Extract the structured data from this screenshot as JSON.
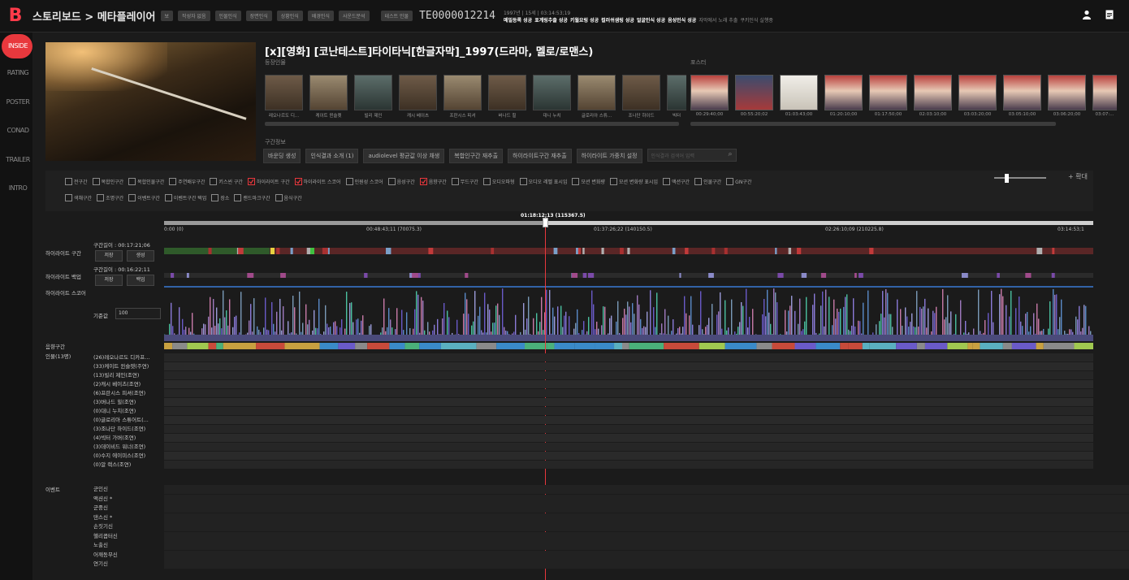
{
  "app": {
    "logo": "B",
    "breadcrumb": "스토리보드 > 메타플레이어",
    "top_buttons": [
      "보",
      "작성자 없음",
      "인물인식",
      "장면인식",
      "상황인식",
      "배경인식",
      "사운드분석"
    ],
    "extra_button": "테스트 인물",
    "content_code": "TE0000012214",
    "status_line1": "1997년 | 15세 | 03:14:53;19",
    "status_items": [
      "메밀등록 성공",
      "표계링추출 성공",
      "키월요링 성공",
      "컬러쉬샘링 성공",
      "얼굴인식 성공",
      "음성인식 성공",
      "자막에서 노래 추출",
      "쿠키인식 실행중"
    ],
    "status_dim_items": [
      "자막에서 노래 추출",
      "쿠키인식 실행중"
    ]
  },
  "nav": [
    {
      "label": "INSIDE",
      "active": true
    },
    {
      "label": "RATING",
      "active": false
    },
    {
      "label": "POSTER",
      "active": false
    },
    {
      "label": "CONAD",
      "active": false
    },
    {
      "label": "TRAILER",
      "active": false
    },
    {
      "label": "INTRO",
      "active": false
    }
  ],
  "content": {
    "title": "[x][영화] [코난테스트]타이타닉[한글자막]_1997(드라마, 멜로/로맨스)",
    "cast_label": "등장인물",
    "poster_label": "포스터",
    "cast": [
      "레오나르도 디...",
      "케이트 윈슬렛",
      "빌리 제인",
      "캐시 베이츠",
      "프란시스 피셔",
      "버나드 힐",
      "대니 누치",
      "글로리아 스튜...",
      "조나단 하이드",
      "빅터"
    ],
    "posters": [
      "00:29:40;00",
      "00:55:20;02",
      "01:03:43;00",
      "01:20:10;00",
      "01:17:50;00",
      "02:03:10;00",
      "03:03:20;00",
      "03:05:10;00",
      "03:06:20;00",
      "03:07:..."
    ]
  },
  "section": {
    "label": "구간정보",
    "buttons": [
      "바운딩 생성",
      "인식결과 소개 (1)",
      "audiolevel 평균값 이상 채생",
      "복합인구간 재추출",
      "하이라이트구간 재추출",
      "하이라이트 가중치 설정"
    ],
    "search_placeholder": "인식결과 검색어 입력"
  },
  "filters": {
    "row1": [
      {
        "label": "전구간",
        "checked": false
      },
      {
        "label": "복합인구간",
        "checked": false
      },
      {
        "label": "복합인물구간",
        "checked": false
      },
      {
        "label": "주연배우구간",
        "checked": false
      },
      {
        "label": "키스씬 구간",
        "checked": false
      },
      {
        "label": "하이라이트 구간",
        "checked": true
      },
      {
        "label": "하이라이트 스코어",
        "checked": true
      },
      {
        "label": "인원성 스코어",
        "checked": false
      },
      {
        "label": "음성구간",
        "checked": false
      },
      {
        "label": "음향구간",
        "checked": true
      },
      {
        "label": "무드구간",
        "checked": false
      },
      {
        "label": "오디오파형",
        "checked": false
      },
      {
        "label": "오디오 레벨 표시임",
        "checked": false
      },
      {
        "label": "모션 변화량",
        "checked": false
      },
      {
        "label": "모션 변화량 표시임",
        "checked": false
      },
      {
        "label": "액션구간",
        "checked": false
      },
      {
        "label": "인물구간",
        "checked": false
      },
      {
        "label": "GN구간",
        "checked": false
      }
    ],
    "row2": [
      {
        "label": "색채구간",
        "checked": false
      },
      {
        "label": "조명구간",
        "checked": false
      },
      {
        "label": "이벤트구간",
        "checked": false
      },
      {
        "label": "이벤트구간 택업",
        "checked": false
      },
      {
        "label": "장소",
        "checked": false
      },
      {
        "label": "랜드마크구간",
        "checked": false
      },
      {
        "label": "음식구간",
        "checked": false
      }
    ],
    "zoom_label": "+ 확대",
    "zoom_level": 0.2
  },
  "timeline": {
    "playhead_time": "01:18:12;13 (115367.5)",
    "ticks": [
      "0:00 (0)",
      "00:48:43;11 (70075.3)",
      "01:37:26;22 (140150.5)",
      "02:26:10;09 (210225.8)",
      "03:14:53;1"
    ],
    "highlight_label": "하이라이트 구간",
    "highlight_len": "구간길이 : 00:17:21;06",
    "save_btn": "저장",
    "create_btn": "생성",
    "backup_label": "하이라이트 백업",
    "backup_len": "구간길이 : 00:16:22;11",
    "backup_save": "저장",
    "backup_btn": "백업",
    "score_label": "하이라이트 스코어",
    "threshold_label": "기준값",
    "threshold_value": "100",
    "sound_label": "음향구간",
    "people_label": "인물(13명)",
    "event_label": "이벤트",
    "people": [
      "(26)레오나르도 디카프...",
      "(33)케이트 윈슬렛(주연)",
      "(13)빌리 제인(조연)",
      "(2)캐시 베이츠(조연)",
      "(6)프란시스 피셔(조연)",
      "(3)버나드 힐(조연)",
      "(0)대니 누치(조연)",
      "(0)글로리아 스튜어트(...",
      "(3)조나단 하이드(조연)",
      "(4)빅터 가버(조연)",
      "(3)데이비드 워너(조연)",
      "(0)수지 에이미스(조연)",
      "(0)알 랙스(조연)"
    ],
    "events": [
      "군인신",
      "액션신 *",
      "군중신",
      "댄스신 *",
      "손짓기신",
      "헬리콥터신",
      "노출신",
      "어깨동무신",
      "연기신"
    ]
  },
  "colors": {
    "accent": "#e8383d",
    "highlight_bar": "#7a2a2a",
    "score_blue": "#3b7bd4"
  }
}
